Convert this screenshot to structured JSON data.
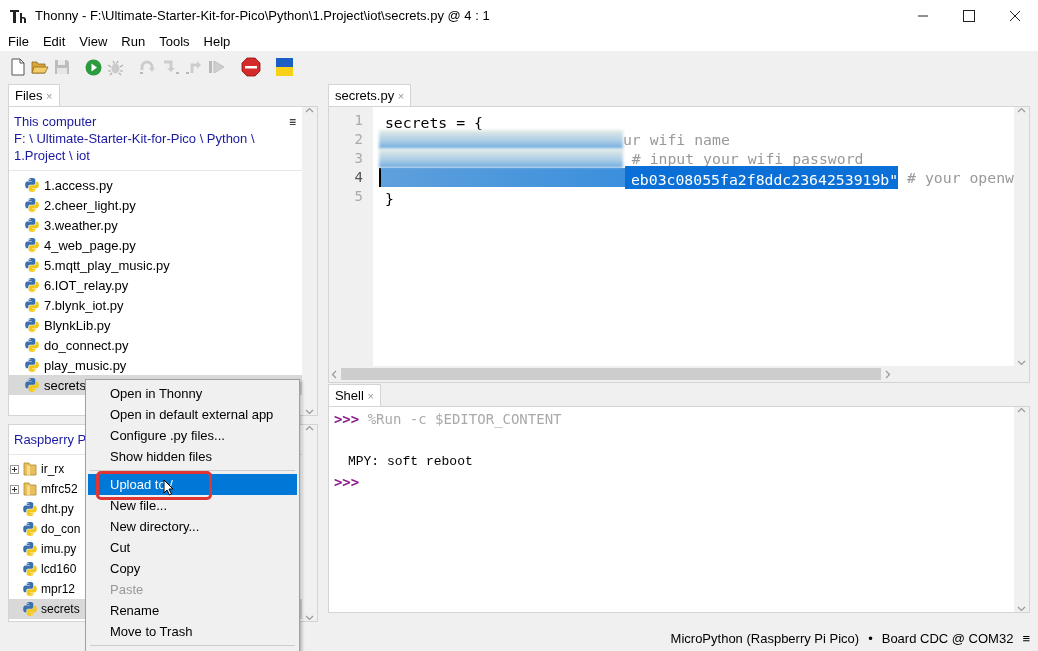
{
  "window": {
    "title": "Thonny  -  F:\\Ultimate-Starter-Kit-for-Pico\\Python\\1.Project\\iot\\secrets.py  @  4 : 1"
  },
  "menu": [
    "File",
    "Edit",
    "View",
    "Run",
    "Tools",
    "Help"
  ],
  "toolbar": [
    {
      "kind": "new",
      "disabled": false
    },
    {
      "kind": "open",
      "disabled": false
    },
    {
      "kind": "save",
      "disabled": true
    },
    {
      "kind": "run",
      "disabled": false
    },
    {
      "kind": "debug",
      "disabled": true
    },
    {
      "kind": "step_over",
      "disabled": true
    },
    {
      "kind": "step_into",
      "disabled": true
    },
    {
      "kind": "step_out",
      "disabled": true
    },
    {
      "kind": "resume",
      "disabled": true
    },
    {
      "kind": "stop",
      "disabled": false
    },
    {
      "kind": "flag",
      "disabled": false
    }
  ],
  "files_panel": {
    "tab": {
      "label": "Files",
      "close": "×"
    },
    "location": "This computer",
    "path": [
      "F: \\ Ultimate-Starter-Kit-for-Pico \\ Python \\",
      "1.Project \\ iot"
    ],
    "menu_glyph": "≡",
    "items": [
      {
        "name": "1.access.py",
        "kind": "file",
        "selected": false
      },
      {
        "name": "2.cheer_light.py",
        "kind": "file",
        "selected": false
      },
      {
        "name": "3.weather.py",
        "kind": "file",
        "selected": false
      },
      {
        "name": "4_web_page.py",
        "kind": "file",
        "selected": false
      },
      {
        "name": "5.mqtt_play_music.py",
        "kind": "file",
        "selected": false
      },
      {
        "name": "6.IOT_relay.py",
        "kind": "file",
        "selected": false
      },
      {
        "name": "7.blynk_iot.py",
        "kind": "file",
        "selected": false
      },
      {
        "name": "BlynkLib.py",
        "kind": "file",
        "selected": false
      },
      {
        "name": "do_connect.py",
        "kind": "file",
        "selected": false
      },
      {
        "name": "play_music.py",
        "kind": "file",
        "selected": false
      },
      {
        "name": "secrets",
        "kind": "file",
        "selected": true
      }
    ]
  },
  "device_panel": {
    "location": "Raspberry P",
    "items": [
      {
        "name": "ir_rx",
        "kind": "folder",
        "selected": false
      },
      {
        "name": "mfrc52",
        "kind": "folder",
        "selected": false
      },
      {
        "name": "dht.py",
        "kind": "file",
        "selected": false
      },
      {
        "name": "do_con",
        "kind": "file",
        "selected": false
      },
      {
        "name": "imu.py",
        "kind": "file",
        "selected": false
      },
      {
        "name": "lcd160",
        "kind": "file",
        "selected": false
      },
      {
        "name": "mpr12",
        "kind": "file",
        "selected": false
      },
      {
        "name": "secrets",
        "kind": "file",
        "selected": true
      }
    ]
  },
  "editor": {
    "tab": {
      "label": "secrets.py",
      "close": "×"
    },
    "lines": [
      {
        "number": "1",
        "redacted": false,
        "current": false,
        "segments": [
          {
            "text": "secrets = {",
            "kind": "code",
            "selected": false
          }
        ]
      },
      {
        "number": "2",
        "redacted": true,
        "current": false,
        "segments": [
          {
            "text": "ur wifi name",
            "kind": "comment",
            "selected": false
          }
        ]
      },
      {
        "number": "3",
        "redacted": true,
        "current": false,
        "segments": [
          {
            "text": " # input your wifi password",
            "kind": "comment",
            "selected": false
          }
        ]
      },
      {
        "number": "4",
        "redacted": true,
        "current": true,
        "segments": [
          {
            "text": "eb03c08055fa2f8ddc2364253919b\"",
            "kind": "code",
            "selected": true
          },
          {
            "text": " # your openw",
            "kind": "comment",
            "selected": false
          }
        ]
      },
      {
        "number": "5",
        "redacted": false,
        "current": false,
        "segments": [
          {
            "text": "}",
            "kind": "code",
            "selected": false
          }
        ]
      }
    ]
  },
  "shell": {
    "tab": {
      "label": "Shell",
      "close": "×"
    },
    "lines": [
      {
        "kind": "prompt",
        "prompt": ">>>",
        "text": " %Run -c $EDITOR_CONTENT"
      },
      {
        "kind": "blank"
      },
      {
        "kind": "output",
        "text": "MPY: soft reboot"
      },
      {
        "kind": "prompt",
        "prompt": ">>>"
      }
    ]
  },
  "context_menu": {
    "items": [
      {
        "kind": "item",
        "label": "Open in Thonny",
        "disabled": false,
        "selected": false,
        "annotated": false
      },
      {
        "kind": "item",
        "label": "Open in default external app",
        "disabled": false,
        "selected": false,
        "annotated": false
      },
      {
        "kind": "item",
        "label": "Configure .py files...",
        "disabled": false,
        "selected": false,
        "annotated": false
      },
      {
        "kind": "item",
        "label": "Show hidden files",
        "disabled": false,
        "selected": false,
        "annotated": false
      },
      {
        "kind": "separator"
      },
      {
        "kind": "item",
        "label": "Upload to /",
        "disabled": false,
        "selected": true,
        "annotated": true
      },
      {
        "kind": "item",
        "label": "New file...",
        "disabled": false,
        "selected": false,
        "annotated": false
      },
      {
        "kind": "item",
        "label": "New directory...",
        "disabled": false,
        "selected": false,
        "annotated": false
      },
      {
        "kind": "item",
        "label": "Cut",
        "disabled": false,
        "selected": false,
        "annotated": false
      },
      {
        "kind": "item",
        "label": "Copy",
        "disabled": false,
        "selected": false,
        "annotated": false
      },
      {
        "kind": "item",
        "label": "Paste",
        "disabled": true,
        "selected": false,
        "annotated": false
      },
      {
        "kind": "item",
        "label": "Rename",
        "disabled": false,
        "selected": false,
        "annotated": false
      },
      {
        "kind": "item",
        "label": "Move to Trash",
        "disabled": false,
        "selected": false,
        "annotated": false
      },
      {
        "kind": "separator"
      }
    ]
  },
  "status_bar": {
    "interpreter": "MicroPython (Raspberry Pi Pico)",
    "separator": "•",
    "port": "Board CDC @ COM32",
    "menu_glyph": "≡"
  }
}
